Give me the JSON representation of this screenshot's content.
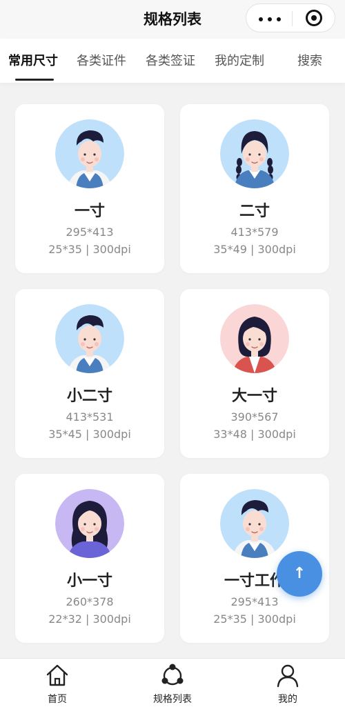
{
  "navbar": {
    "title": "规格列表"
  },
  "tabs": [
    {
      "label": "常用尺寸",
      "active": true
    },
    {
      "label": "各类证件",
      "active": false
    },
    {
      "label": "各类签证",
      "active": false
    },
    {
      "label": "我的定制",
      "active": false
    },
    {
      "label": "搜索",
      "active": false
    }
  ],
  "cards": [
    {
      "name": "一寸",
      "pixels": "295*413",
      "size": "25*35 | 300dpi",
      "avatar": "boy",
      "bg": "#bfe0fb"
    },
    {
      "name": "二寸",
      "pixels": "413*579",
      "size": "35*49 | 300dpi",
      "avatar": "girl-braids",
      "bg": "#bfe0fb"
    },
    {
      "name": "小二寸",
      "pixels": "413*531",
      "size": "35*45 | 300dpi",
      "avatar": "boy",
      "bg": "#bfe0fb"
    },
    {
      "name": "大一寸",
      "pixels": "390*567",
      "size": "33*48 | 300dpi",
      "avatar": "woman-short",
      "bg": "#fbd6d6"
    },
    {
      "name": "小一寸",
      "pixels": "260*378",
      "size": "22*32 | 300dpi",
      "avatar": "woman-long",
      "bg": "#c7b8f4"
    },
    {
      "name": "一寸工作",
      "pixels": "295*413",
      "size": "25*35 | 300dpi",
      "avatar": "boy",
      "bg": "#bfe0fb"
    }
  ],
  "fab": {
    "label": "↑",
    "icon": "arrow-up-icon"
  },
  "tabbar": [
    {
      "label": "首页",
      "icon": "home-icon"
    },
    {
      "label": "规格列表",
      "icon": "spec-list-icon"
    },
    {
      "label": "我的",
      "icon": "user-icon"
    }
  ],
  "colors": {
    "accent": "#4a90e2",
    "background": "#f2f2f2"
  }
}
